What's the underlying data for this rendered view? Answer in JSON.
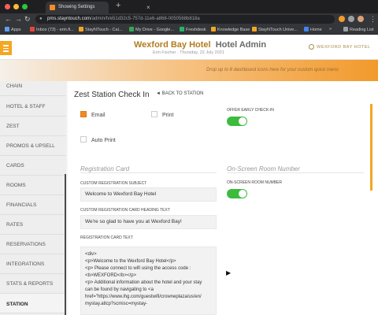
{
  "browser": {
    "tab_title": "Showing Settings",
    "tab_close": "×",
    "new_tab": "+",
    "url_host": "pms.stayntouch.com",
    "url_path": "/admin/h/e51d32c5-757d-11e6-a868-0050568b818a",
    "bookmarks": [
      "Apps",
      "Inbox (73) - erin.fi...",
      "StayNTouch - Cal...",
      "My Drive - Google...",
      "Freshdesk",
      "Knowledge Base",
      "StayNTouch Unive...",
      "Home",
      "»",
      "Reading List"
    ]
  },
  "header": {
    "hotel_name": "Wexford Bay Hotel",
    "admin_label": "Hotel Admin",
    "subtitle": "Erin Fischer  ·  Thursday, 22 July 2021",
    "logo_text": "WEXFORD BAY HOTEL"
  },
  "dropbar": {
    "text": "Drop up to 8 dashboard icons here for your custom quick menu"
  },
  "sidebar": {
    "items": [
      "CHAIN",
      "HOTEL & STAFF",
      "ZEST",
      "PROMOS & UPSELL",
      "CARDS",
      "ROOMS",
      "FINANCIALS",
      "RATES",
      "RESERVATIONS",
      "INTEGRATIONS",
      "STATS & REPORTS",
      "STATION"
    ],
    "active": "STATION"
  },
  "main": {
    "title": "Zest Station Check In",
    "back_link": "◄  BACK TO STATION",
    "email_label": "Email",
    "print_label": "Print",
    "auto_print_label": "Auto Print",
    "offer_early_label": "OFFER EARLY CHECK-IN",
    "registration_card_title": "Registration Card",
    "onscreen_title": "On-Screen Room Number",
    "onscreen_label": "ON-SCREEN ROOM NUMBER",
    "subject_label": "CUSTOM REGISTRATION SUBJECT",
    "subject_value": "Welcome  to Wexford Bay Hotel",
    "heading_label": "CUSTOM REGISTRATION CARD HEADING TEXT",
    "heading_value": "We're so glad to have you at  Wexford Bay!",
    "card_text_label": "REGISTRATION CARD TEXT",
    "card_text_lines": [
      "<div>",
      "   <p>Welcome to the Wexford Bay Hotel</p>",
      "   <p> Please connect to wifi using the access code :",
      "<b>WEXFORD</b></p>",
      "   <p> Additional information about the hotel and your stay",
      "can be found by navigating to <a",
      "href=\"https://www.ihg.com/guestwifi/crowneplaza/us/en/",
      "mystay.atlcp?scmisc=mystay-"
    ]
  },
  "colors": {
    "accent": "#f5a623",
    "toggle_on": "#3dbb3d",
    "hotel_name": "#b07d1e"
  }
}
